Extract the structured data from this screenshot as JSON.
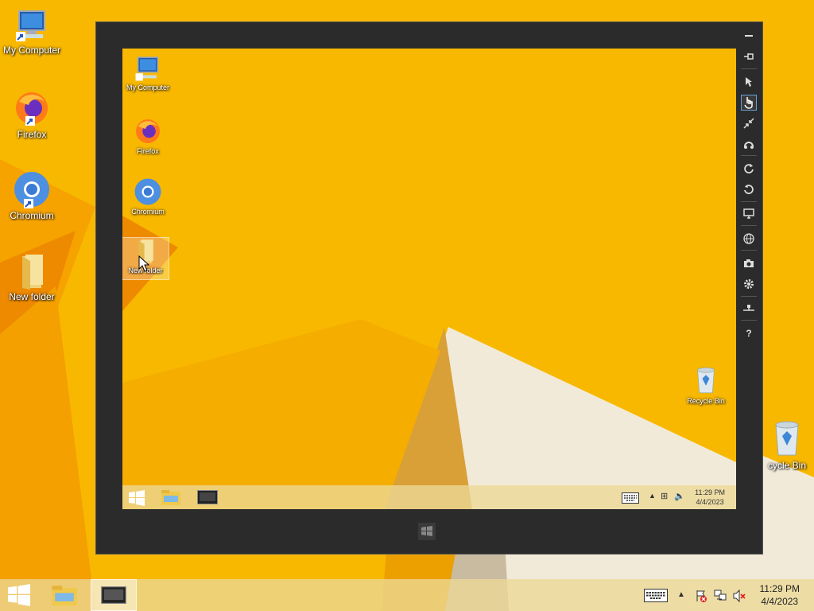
{
  "desktop": {
    "icons": [
      {
        "label": "My Computer",
        "icon": "computer-icon"
      },
      {
        "label": "Firefox",
        "icon": "firefox-icon"
      },
      {
        "label": "Chromium",
        "icon": "chromium-icon"
      },
      {
        "label": "New folder",
        "icon": "folder-icon"
      },
      {
        "label": "cycle Bin",
        "icon": "recycle-bin-icon"
      }
    ]
  },
  "simulator": {
    "icons": [
      {
        "label": "My Computer",
        "icon": "computer-icon"
      },
      {
        "label": "Firefox",
        "icon": "firefox-icon"
      },
      {
        "label": "Chromium",
        "icon": "chromium-icon"
      },
      {
        "label": "New folder",
        "icon": "folder-icon"
      },
      {
        "label": "Recycle Bin",
        "icon": "recycle-bin-icon"
      }
    ],
    "taskbar": {
      "time": "11:29 PM",
      "date": "4/4/2023"
    },
    "tools": [
      "minimize-icon",
      "pin-icon",
      "pointer-icon",
      "touch-icon",
      "pinch-icon",
      "rotate-gesture-icon",
      "rotate-clockwise-icon",
      "rotate-counterclockwise-icon",
      "display-icon",
      "globe-icon",
      "camera-icon",
      "settings-icon",
      "network-icon",
      "help-icon"
    ],
    "help_label": "?"
  },
  "taskbar": {
    "time": "11:29 PM",
    "date": "4/4/2023"
  },
  "colors": {
    "wallpaper": "#f7b500",
    "accent_orange": "#f08a00",
    "simulator_frame": "#2b2b2b"
  }
}
